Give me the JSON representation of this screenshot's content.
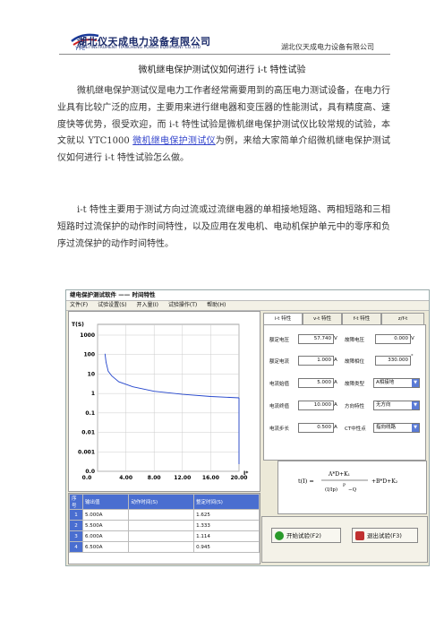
{
  "header": {
    "company_cn": "湖北仪天成电力设备有限公司",
    "company_en": "HUBEI INSTRUMENT TIANCHENG POWER EQUIPMENT CO.,LTD",
    "logo_text": "YTC",
    "right_text": "湖北仪天成电力设备有限公司"
  },
  "doc": {
    "title": "微机继电保护测试仪如何进行 i-t 特性试验",
    "p1": "微机继电保护测试仪是电力工作者经常需要用到的高压电力测试设备，在电力行业具有比较广泛的应用，主要用来进行继电器和变压器的性能测试，具有精度高、速度快等优势，很受欢迎，而 i-t 特性试验是微机继电保护测试仪比较常规的试验，本文就以 YTC1000 ",
    "p1_link": "微机继电保护测试仪",
    "p1_tail": "为例，来给大家简单介绍微机继电保护测试仪如何进行 i-t 特性试验怎么做。",
    "p2": "i-t 特性主要用于测试方向过流或过流继电器的单相接地短路、两相短路和三相短路时过流保护的动作时间特性，以及应用在发电机、电动机保护单元中的零序和负序过流保护的动作时间特性。"
  },
  "app": {
    "window_title": "继电保护测试软件 —— 时间特性",
    "menu": [
      "文件(F)",
      "试验设置(S)",
      "开入量(I)",
      "试验操作(T)",
      "帮助(H)"
    ],
    "tabs": [
      "i-t 特性",
      "v-t 特性",
      "f-t 特性",
      "z/f-t"
    ],
    "fields": {
      "rated_voltage_label": "额定电压",
      "rated_voltage": "57.740",
      "rated_voltage_unit": "V",
      "fault_voltage_label": "故障电压",
      "fault_voltage": "0.000",
      "fault_voltage_unit": "V",
      "rated_current_label": "额定电流",
      "rated_current": "1.000",
      "rated_current_unit": "A",
      "fault_angle_label": "故障相位",
      "fault_angle": "330.000",
      "fault_angle_unit": "°",
      "current_start_label": "电流始值",
      "current_start": "5.000",
      "current_start_unit": "A",
      "fault_type_label": "故障类型",
      "fault_type": "A相接地",
      "current_end_label": "电流终值",
      "current_end": "10.000",
      "current_end_unit": "A",
      "direction_label": "方向特性",
      "direction": "无方向",
      "current_step_label": "电流步长",
      "current_step": "0.500",
      "current_step_unit": "A",
      "ct_polarity_label": "CT中性点",
      "ct_polarity": "指向线路"
    },
    "formula": {
      "lhs": "t(I) =",
      "num": "A*D+K₁",
      "den_top": "(I/Ip)",
      "den_p": "P",
      "den_tail": "−Q",
      "rhs": "+B*D+K₂"
    },
    "buttons": {
      "start": "开始试验(F2)",
      "stop": "退出试验(F3)"
    },
    "table": {
      "headers": [
        "序号",
        "输出值",
        "动作时间(S)",
        "整定时间(S)"
      ],
      "rows": [
        [
          "1",
          "5.000A",
          "",
          "1.625"
        ],
        [
          "2",
          "5.500A",
          "",
          "1.333"
        ],
        [
          "3",
          "6.000A",
          "",
          "1.114"
        ],
        [
          "4",
          "6.500A",
          "",
          "0.945"
        ]
      ]
    }
  },
  "chart_data": {
    "type": "line",
    "xlabel": "I*",
    "ylabel": "T(S)",
    "x_ticks": [
      "0.0",
      "4.00",
      "8.00",
      "12.00",
      "16.00",
      "20.00"
    ],
    "y_ticks": [
      "1000",
      "100",
      "10",
      "1",
      "0.1",
      "0.01",
      "0.001",
      "0.0"
    ],
    "x": [
      1.05,
      1.2,
      1.5,
      2,
      3,
      5,
      8,
      12,
      16,
      20
    ],
    "y": [
      110,
      40,
      14,
      8,
      4,
      2.2,
      1.3,
      0.9,
      0.7,
      0.6
    ]
  }
}
